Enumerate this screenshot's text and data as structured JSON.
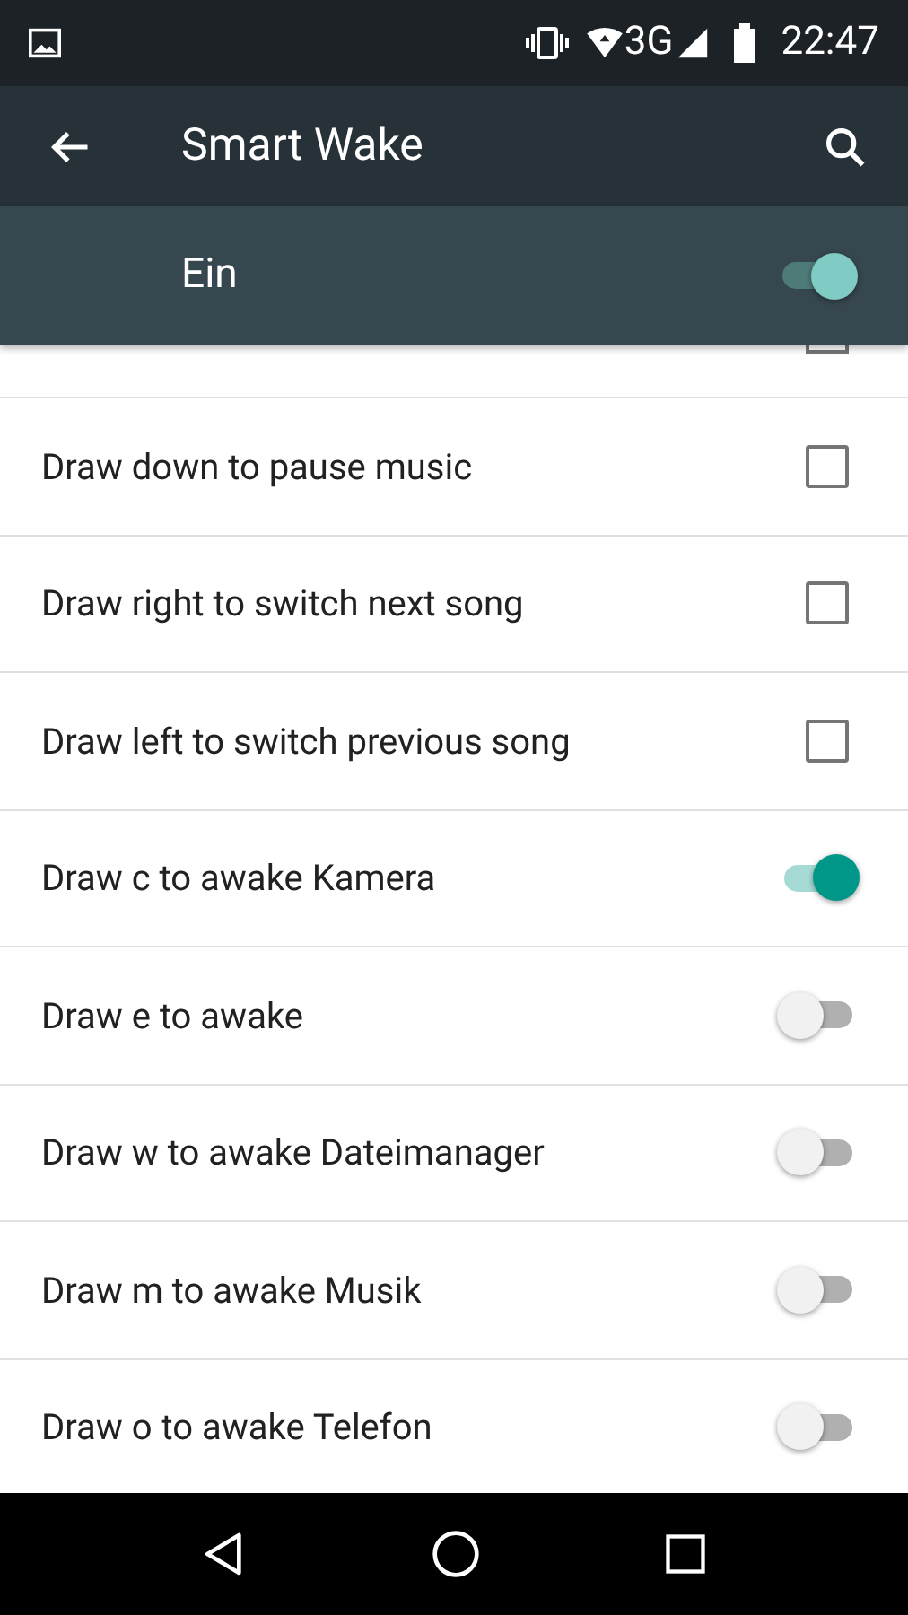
{
  "status_bar": {
    "time": "22:47",
    "network": "3G"
  },
  "toolbar": {
    "title": "Smart Wake"
  },
  "master_switch": {
    "label": "Ein",
    "on": true
  },
  "items": [
    {
      "kind": "cut_off"
    },
    {
      "kind": "checkbox",
      "label": "Draw down to pause music",
      "checked": false
    },
    {
      "kind": "checkbox",
      "label": "Draw right to switch next song",
      "checked": false
    },
    {
      "kind": "checkbox",
      "label": "Draw left to switch previous song",
      "checked": false
    },
    {
      "kind": "switch",
      "label": "Draw c to awake Kamera",
      "on": true
    },
    {
      "kind": "switch",
      "label": "Draw e to awake",
      "on": false
    },
    {
      "kind": "switch",
      "label": "Draw w to awake Dateimanager",
      "on": false
    },
    {
      "kind": "switch",
      "label": "Draw m to awake Musik",
      "on": false
    },
    {
      "kind": "switch",
      "label": "Draw o to awake Telefon",
      "on": false
    }
  ]
}
